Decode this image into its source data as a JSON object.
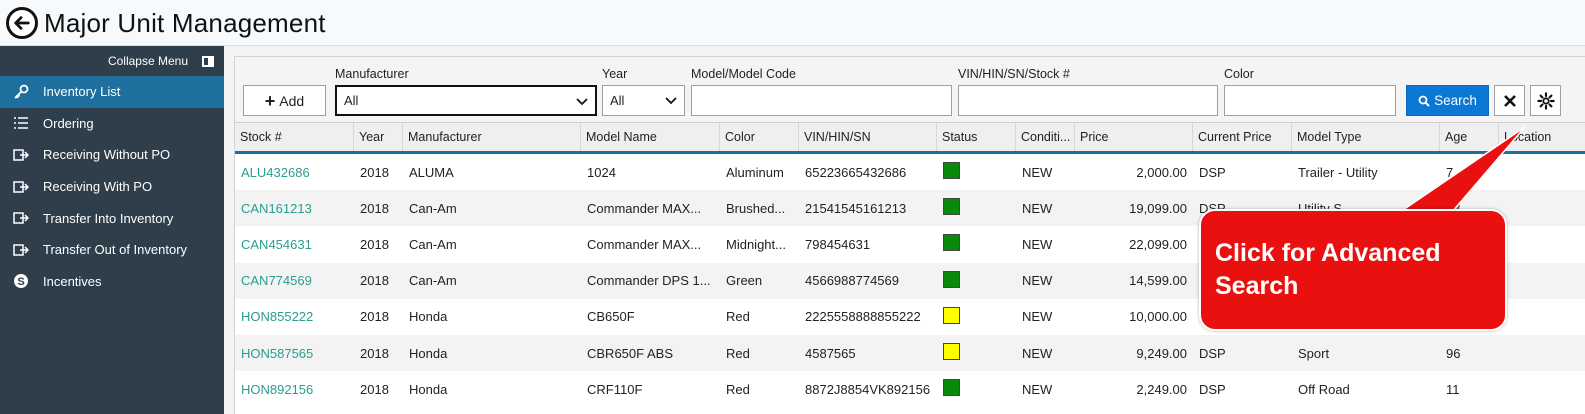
{
  "header": {
    "title": "Major Unit Management"
  },
  "sidebar": {
    "collapse_label": "Collapse Menu",
    "items": [
      {
        "label": "Inventory List",
        "icon": "key-icon",
        "active": true
      },
      {
        "label": "Ordering",
        "icon": "list-icon"
      },
      {
        "label": "Receiving Without PO",
        "icon": "receive-icon"
      },
      {
        "label": "Receiving With PO",
        "icon": "receive-icon"
      },
      {
        "label": "Transfer Into Inventory",
        "icon": "transfer-in-icon"
      },
      {
        "label": "Transfer Out of Inventory",
        "icon": "transfer-out-icon"
      },
      {
        "label": "Incentives",
        "icon": "dollar-icon"
      }
    ]
  },
  "filters": {
    "add_label": "Add",
    "manufacturer_label": "Manufacturer",
    "manufacturer_value": "All",
    "year_label": "Year",
    "year_value": "All",
    "model_label": "Model/Model Code",
    "model_value": "",
    "vin_label": "VIN/HIN/SN/Stock #",
    "vin_value": "",
    "color_label": "Color",
    "color_value": "",
    "search_label": "Search"
  },
  "table": {
    "headers": [
      "Stock #",
      "Year",
      "Manufacturer",
      "Model Name",
      "Color",
      "VIN/HIN/SN",
      "Status",
      "Conditi...",
      "Price",
      "Current Price",
      "Model Type",
      "Age",
      "Location"
    ],
    "rows": [
      {
        "stock": "ALU432686",
        "year": "2018",
        "manufacturer": "ALUMA",
        "model": "1024",
        "color": "Aluminum",
        "vin": "65223665432686",
        "status": "green",
        "condition": "NEW",
        "price": "2,000.00",
        "current_price": "DSP",
        "model_type": "Trailer - Utility",
        "age": "7",
        "location": ""
      },
      {
        "stock": "CAN161213",
        "year": "2018",
        "manufacturer": "Can-Am",
        "model": "Commander MAX...",
        "color": "Brushed...",
        "vin": "21541545161213",
        "status": "green",
        "condition": "NEW",
        "price": "19,099.00",
        "current_price": "DSP",
        "model_type": "Utility S...",
        "age": "78",
        "location": ""
      },
      {
        "stock": "CAN454631",
        "year": "2018",
        "manufacturer": "Can-Am",
        "model": "Commander MAX...",
        "color": "Midnight...",
        "vin": "798454631",
        "status": "green",
        "condition": "NEW",
        "price": "22,099.00",
        "current_price": "",
        "model_type": "",
        "age": "",
        "location": ""
      },
      {
        "stock": "CAN774569",
        "year": "2018",
        "manufacturer": "Can-Am",
        "model": "Commander DPS 1...",
        "color": "Green",
        "vin": "4566988774569",
        "status": "green",
        "condition": "NEW",
        "price": "14,599.00",
        "current_price": "",
        "model_type": "",
        "age": "",
        "location": ""
      },
      {
        "stock": "HON855222",
        "year": "2018",
        "manufacturer": "Honda",
        "model": "CB650F",
        "color": "Red",
        "vin": "2225558888855222",
        "status": "yellow",
        "condition": "NEW",
        "price": "10,000.00",
        "current_price": "",
        "model_type": "",
        "age": "",
        "location": ""
      },
      {
        "stock": "HON587565",
        "year": "2018",
        "manufacturer": "Honda",
        "model": "CBR650F ABS",
        "color": "Red",
        "vin": "4587565",
        "status": "yellow",
        "condition": "NEW",
        "price": "9,249.00",
        "current_price": "DSP",
        "model_type": "Sport",
        "age": "96",
        "location": ""
      },
      {
        "stock": "HON892156",
        "year": "2018",
        "manufacturer": "Honda",
        "model": "CRF110F",
        "color": "Red",
        "vin": "8872J8854VK892156",
        "status": "green",
        "condition": "NEW",
        "price": "2,249.00",
        "current_price": "DSP",
        "model_type": "Off Road",
        "age": "11",
        "location": ""
      }
    ]
  },
  "callout": {
    "text_line1": "Click for Advanced",
    "text_line2": "Search"
  },
  "colors": {
    "accent": "#0a78d4",
    "sidebar_bg": "#2e3e4a",
    "active_item": "#1f6f9e",
    "link": "#2a9d8f",
    "callout": "#ea1010",
    "status_green": "#0a8a0a",
    "status_yellow": "#ffff00"
  }
}
